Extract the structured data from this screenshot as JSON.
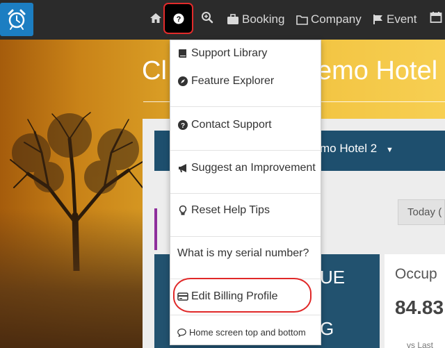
{
  "navbar": {
    "logo_icon": "alarm-clock-icon",
    "home_icon": "home-icon",
    "help_icon": "question-circle-icon",
    "search_icon": "zoom-in-icon",
    "links": [
      {
        "label": "Booking",
        "icon": "briefcase-icon"
      },
      {
        "label": "Company",
        "icon": "folder-icon"
      },
      {
        "label": "Event",
        "icon": "flag-icon"
      }
    ],
    "calendar_icon": "calendar-icon"
  },
  "hero": {
    "title_left": "Cl",
    "title_right": "emo Hotel"
  },
  "panel": {
    "hotel_select": "mo Hotel 2",
    "today_button": "Today (",
    "dark_card": [
      "UE",
      "G"
    ],
    "occupancy_title": "Occup",
    "occupancy_value": "84.83",
    "occupancy_sub": "vs Last"
  },
  "dropdown": {
    "items": [
      {
        "label": "Support Library",
        "icon": "book-icon"
      },
      {
        "label": "Feature Explorer",
        "icon": "compass-icon"
      },
      {
        "label": "Contact Support",
        "icon": "question-circle-icon"
      },
      {
        "label": "Suggest an Improvement",
        "icon": "bullhorn-icon"
      },
      {
        "label": "Reset Help Tips",
        "icon": "lightbulb-icon"
      },
      {
        "label": "What is my serial number?",
        "icon": ""
      },
      {
        "label": "Edit Billing Profile",
        "icon": "credit-card-icon"
      },
      {
        "label": "Home screen top and bottom",
        "icon": "speech-bubble-icon"
      }
    ]
  },
  "colors": {
    "navbar": "#2b2b2b",
    "logo_bg": "#1c7ec2",
    "highlight": "#e32b2b",
    "panel_header": "#1e4f6e"
  }
}
